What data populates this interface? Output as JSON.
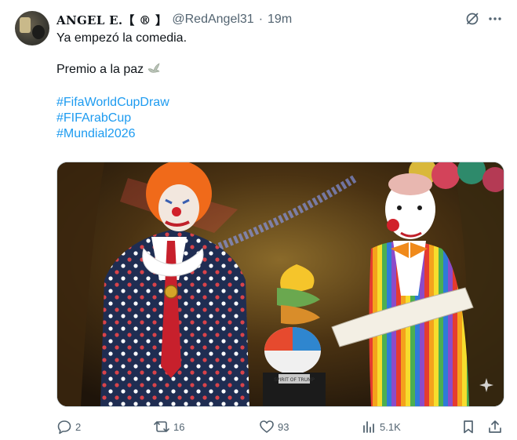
{
  "tweet": {
    "author_name": "ANGEL E.【 ® 】",
    "author_handle": "@RedAngel31",
    "separator": "·",
    "time": "19m",
    "lines": [
      "Ya empezó la comedia.",
      "",
      "Premio a la paz",
      "",
      "#FifaWorldCupDraw",
      "#FIFArabCup",
      "#Mundial2026"
    ],
    "icons": {
      "more": "more-horizontal-icon",
      "grok": "grok-icon",
      "dove": "dove-icon",
      "sparkle": "sparkle-icon"
    }
  },
  "media": {
    "stage_label": "SPIRIT OF TRUMP"
  },
  "actions": {
    "replies": "2",
    "reposts": "16",
    "likes": "93",
    "views": "5.1K"
  },
  "colors": {
    "link": "#1d9bf0",
    "secondary_text": "#536471",
    "primary_text": "#0f1419"
  }
}
